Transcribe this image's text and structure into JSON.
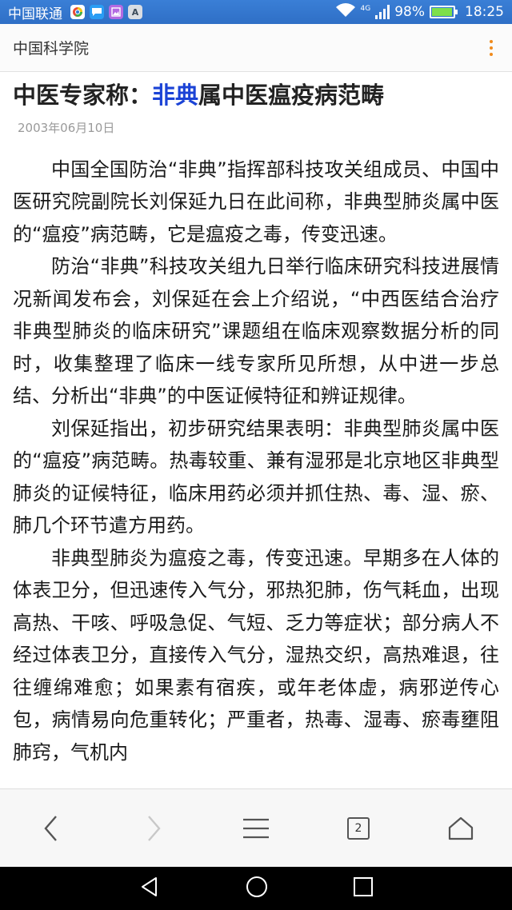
{
  "status_bar": {
    "carrier": "中国联通",
    "network_type": "4G",
    "battery_percent": "98%",
    "battery_level": 0.98,
    "time": "18:25",
    "notification_icons": [
      "browser-app-icon",
      "message-app-icon",
      "gallery-app-icon",
      "font-app-icon"
    ],
    "font_app_letter": "A"
  },
  "header": {
    "site_name": "中国科学院"
  },
  "article": {
    "title_prefix": "中医专家称：",
    "title_highlight": "非典",
    "title_suffix": "属中医瘟疫病范畴",
    "date": "2003年06月10日",
    "paragraphs": [
      "中国全国防治“非典”指挥部科技攻关组成员、中国中医研究院副院长刘保延九日在此间称，非典型肺炎属中医的“瘟疫”病范畴，它是瘟疫之毒，传变迅速。",
      "防治“非典”科技攻关组九日举行临床研究科技进展情况新闻发布会，刘保延在会上介绍说，“中西医结合治疗非典型肺炎的临床研究”课题组在临床观察数据分析的同时，收集整理了临床一线专家所见所想，从中进一步总结、分析出“非典”的中医证候特征和辨证规律。",
      "刘保延指出，初步研究结果表明：非典型肺炎属中医的“瘟疫”病范畴。热毒较重、兼有湿邪是北京地区非典型肺炎的证候特征，临床用药必须并抓住热、毒、湿、瘀、肺几个环节遣方用药。",
      "非典型肺炎为瘟疫之毒，传变迅速。早期多在人体的体表卫分，但迅速传入气分，邪热犯肺，伤气耗血，出现高热、干咳、呼吸急促、气短、乏力等症状；部分病人不经过体表卫分，直接传入气分，湿热交织，高热难退，往往缠绵难愈；如果素有宿疾，或年老体虚，病邪逆传心包，病情易向危重转化；严重者，热毒、湿毒、瘀毒壅阻肺窍，气机内"
    ]
  },
  "bottom_nav": {
    "tab_count": "2",
    "items": [
      "back-icon",
      "forward-icon",
      "menu-icon",
      "tabs-icon",
      "home-icon"
    ]
  },
  "system_nav": {
    "items": [
      "system-back-icon",
      "system-home-icon",
      "system-recents-icon"
    ]
  }
}
